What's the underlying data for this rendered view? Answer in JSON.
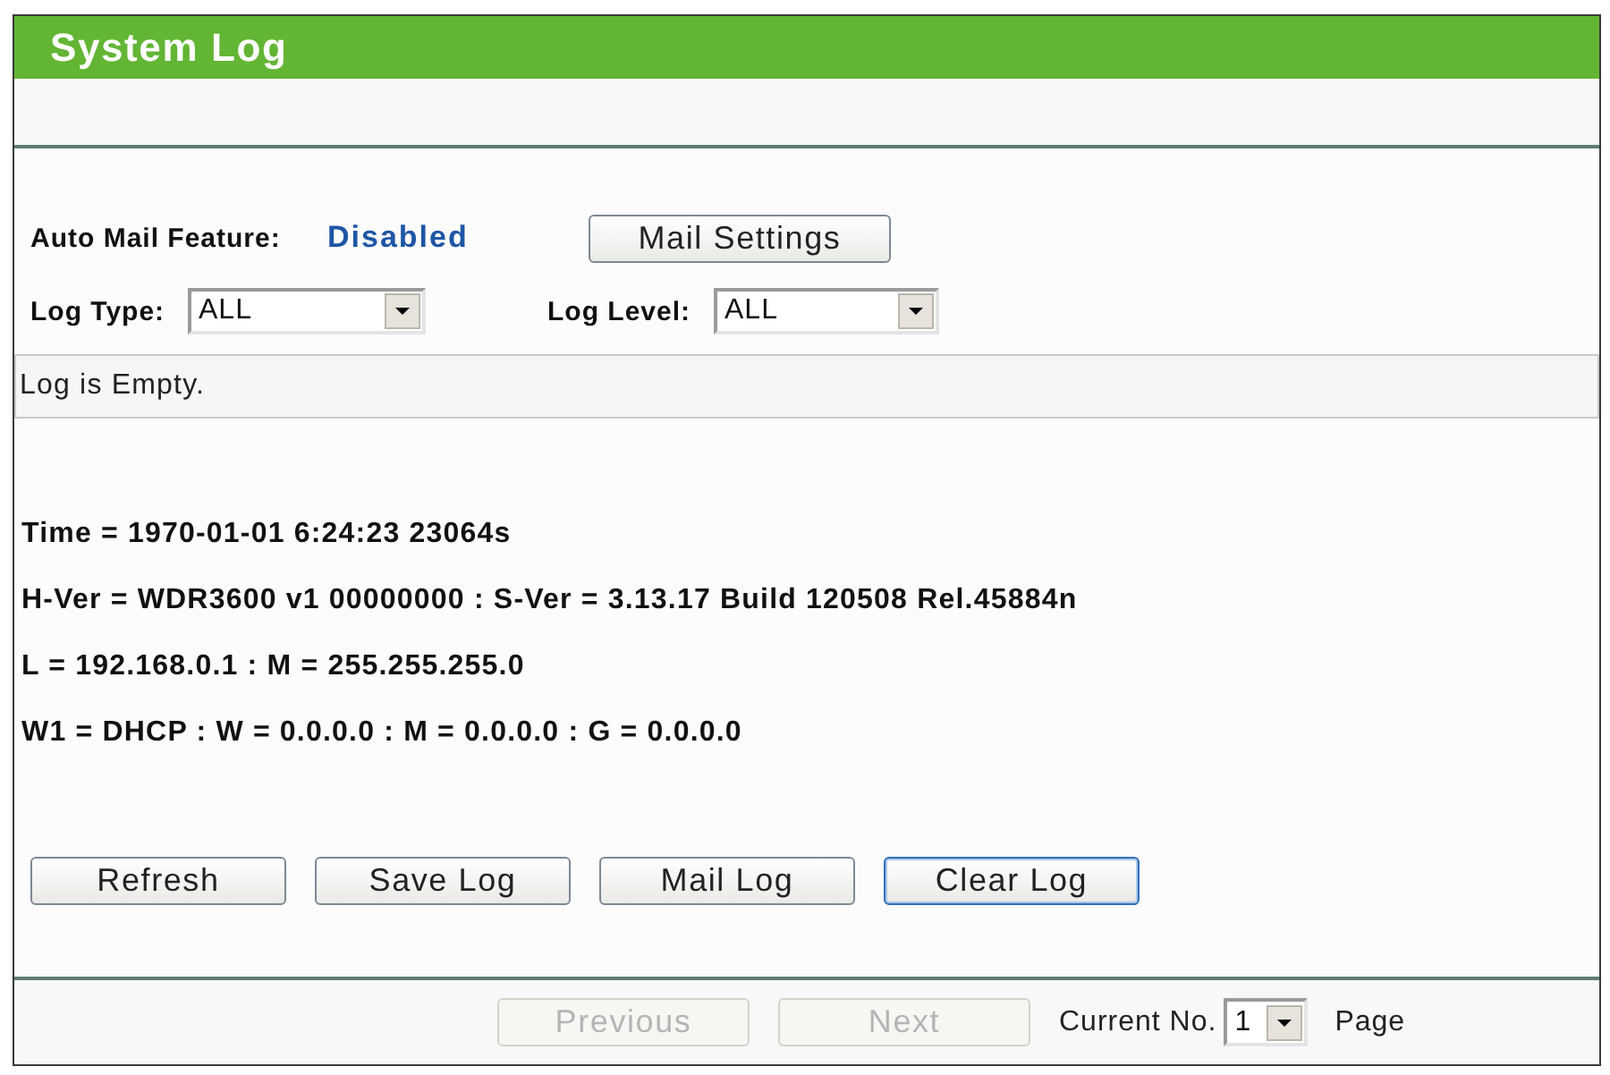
{
  "header": {
    "title": "System Log"
  },
  "auto_mail": {
    "label": "Auto Mail Feature:",
    "value": "Disabled",
    "button": "Mail Settings"
  },
  "filters": [
    {
      "label": "Log Type:",
      "value": "ALL"
    },
    {
      "label": "Log Level:",
      "value": "ALL"
    }
  ],
  "log": {
    "text": "Log is Empty."
  },
  "info_lines": [
    "Time = 1970-01-01 6:24:23 23064s",
    "H-Ver = WDR3600 v1 00000000 : S-Ver = 3.13.17 Build 120508 Rel.45884n",
    "L = 192.168.0.1 : M = 255.255.255.0",
    "W1 = DHCP : W = 0.0.0.0 : M = 0.0.0.0 : G = 0.0.0.0"
  ],
  "buttons": [
    {
      "label": "Refresh",
      "focused": false
    },
    {
      "label": "Save Log",
      "focused": false
    },
    {
      "label": "Mail Log",
      "focused": false
    },
    {
      "label": "Clear Log",
      "focused": true
    }
  ],
  "pager": {
    "previous": {
      "label": "Previous",
      "disabled": true
    },
    "next": {
      "label": "Next",
      "disabled": true
    },
    "current_label": "Current No.",
    "current_value": "1",
    "page_label": "Page"
  }
}
